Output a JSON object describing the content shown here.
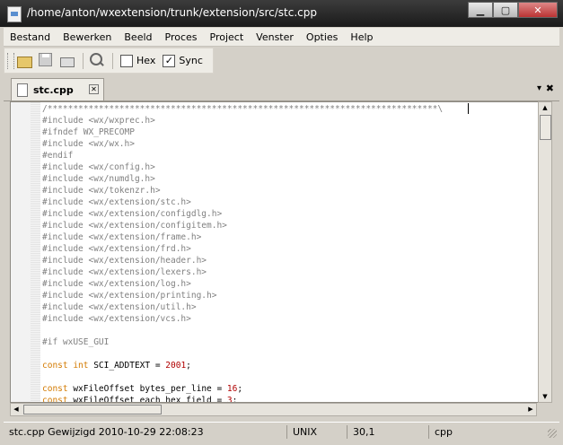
{
  "window": {
    "title": "/home/anton/wxextension/trunk/extension/src/stc.cpp",
    "min_label": "▁",
    "max_label": "▢",
    "close_label": "✕"
  },
  "menu": [
    {
      "label": "Bestand"
    },
    {
      "label": "Bewerken"
    },
    {
      "label": "Beeld"
    },
    {
      "label": "Proces"
    },
    {
      "label": "Project"
    },
    {
      "label": "Venster"
    },
    {
      "label": "Opties"
    },
    {
      "label": "Help"
    }
  ],
  "toolbar": {
    "hex_label": "Hex",
    "hex_checked": false,
    "sync_label": "Sync",
    "sync_checked": true,
    "check_mark": "✓",
    "icons": [
      "open-icon",
      "save-icon",
      "print-icon",
      "find-icon"
    ]
  },
  "tabs": {
    "active_label": "stc.cpp",
    "close_glyph": "✕",
    "menu_glyph": "▾",
    "closeall_glyph": "✖"
  },
  "editor": {
    "lines": [
      {
        "text": "/****************************************************************************\\",
        "style": "first-line"
      },
      {
        "text": "#include <wx/wxprec.h>",
        "style": "c-comment"
      },
      {
        "text": "#ifndef WX_PRECOMP",
        "style": "c-comment"
      },
      {
        "text": "#include <wx/wx.h>",
        "style": "c-comment"
      },
      {
        "text": "#endif",
        "style": "c-comment"
      },
      {
        "text": "#include <wx/config.h>",
        "style": "c-comment"
      },
      {
        "text": "#include <wx/numdlg.h>",
        "style": "c-comment"
      },
      {
        "text": "#include <wx/tokenzr.h>",
        "style": "c-comment"
      },
      {
        "text": "#include <wx/extension/stc.h>",
        "style": "c-comment"
      },
      {
        "text": "#include <wx/extension/configdlg.h>",
        "style": "c-comment"
      },
      {
        "text": "#include <wx/extension/configitem.h>",
        "style": "c-comment"
      },
      {
        "text": "#include <wx/extension/frame.h>",
        "style": "c-comment"
      },
      {
        "text": "#include <wx/extension/frd.h>",
        "style": "c-comment"
      },
      {
        "text": "#include <wx/extension/header.h>",
        "style": "c-comment"
      },
      {
        "text": "#include <wx/extension/lexers.h>",
        "style": "c-comment"
      },
      {
        "text": "#include <wx/extension/log.h>",
        "style": "c-comment"
      },
      {
        "text": "#include <wx/extension/printing.h>",
        "style": "c-comment"
      },
      {
        "text": "#include <wx/extension/util.h>",
        "style": "c-comment"
      },
      {
        "text": "#include <wx/extension/vcs.h>",
        "style": "c-comment"
      },
      {
        "text": "",
        "style": "c-plain"
      },
      {
        "text": "#if wxUSE_GUI",
        "style": "c-comment"
      },
      {
        "text": "",
        "style": "c-plain"
      },
      {
        "parts": [
          {
            "text": "const int ",
            "style": "c-kw"
          },
          {
            "text": "SCI_ADDTEXT = ",
            "style": "c-plain"
          },
          {
            "text": "2001",
            "style": "c-num"
          },
          {
            "text": ";",
            "style": "c-plain"
          }
        ]
      },
      {
        "text": "",
        "style": "c-plain"
      },
      {
        "parts": [
          {
            "text": "const ",
            "style": "c-kw"
          },
          {
            "text": "wxFileOffset bytes_per_line = ",
            "style": "c-plain"
          },
          {
            "text": "16",
            "style": "c-num"
          },
          {
            "text": ";",
            "style": "c-plain"
          }
        ]
      },
      {
        "parts": [
          {
            "text": "const ",
            "style": "c-kw"
          },
          {
            "text": "wxFileOffset each_hex_field = ",
            "style": "c-plain"
          },
          {
            "text": "3",
            "style": "c-num"
          },
          {
            "text": ";",
            "style": "c-plain"
          }
        ]
      }
    ]
  },
  "status": {
    "message": "stc.cpp Gewijzigd 2010-10-29 22:08:23",
    "eol": "UNIX",
    "position": "30,1",
    "lexer": "cpp"
  }
}
